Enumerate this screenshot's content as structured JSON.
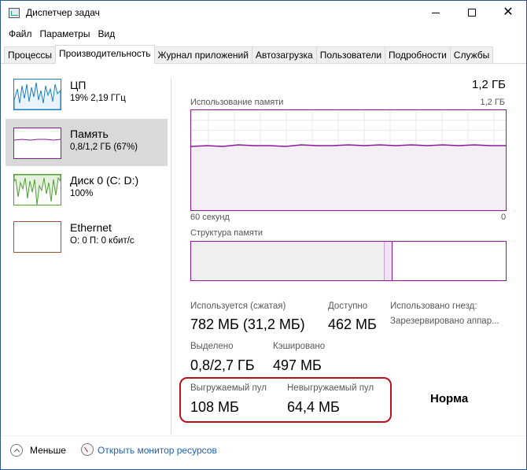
{
  "window": {
    "title": "Диспетчер задач"
  },
  "menu": [
    "Файл",
    "Параметры",
    "Вид"
  ],
  "tabs": [
    {
      "label": "Процессы",
      "active": false
    },
    {
      "label": "Производительность",
      "active": true
    },
    {
      "label": "Журнал приложений",
      "active": false
    },
    {
      "label": "Автозагрузка",
      "active": false
    },
    {
      "label": "Пользователи",
      "active": false
    },
    {
      "label": "Подробности",
      "active": false
    },
    {
      "label": "Службы",
      "active": false
    }
  ],
  "sidebar": {
    "items": [
      {
        "name": "ЦП",
        "detail": "19%  2,19 ГГц",
        "color": "#1c7fbf"
      },
      {
        "name": "Память",
        "detail": "0,8/1,2 ГБ (67%)",
        "color": "#8b1a9b"
      },
      {
        "name": "Диск 0 (C: D:)",
        "detail": "100%",
        "color": "#4da033"
      },
      {
        "name": "Ethernet",
        "detail": "О: 0 П: 0 кбит/с",
        "color": "#a0522d"
      }
    ]
  },
  "main": {
    "total": "1,2 ГБ",
    "usage_chart": {
      "label": "Использование памяти",
      "max_label": "1,2 ГБ",
      "time_left": "60 секунд",
      "time_right": "0",
      "level_percent": 67
    },
    "structure": {
      "label": "Структура памяти",
      "used_fraction": 0.61,
      "modified_fraction": 0.025
    },
    "stats": {
      "in_use_label": "Используется (сжатая)",
      "in_use_value": "782 МБ (31,2 МБ)",
      "available_label": "Доступно",
      "available_value": "462 МБ",
      "slots_label": "Использовано гнезд:",
      "slots_value": "Зарезервировано аппар...",
      "committed_label": "Выделено",
      "committed_value": "0,8/2,7 ГБ",
      "cached_label": "Кэшировано",
      "cached_value": "497 МБ",
      "paged_label": "Выгружаемый пул",
      "paged_value": "108 МБ",
      "nonpaged_label": "Невыгружаемый пул",
      "nonpaged_value": "64,4 МБ"
    },
    "annotation": "Норма"
  },
  "footer": {
    "less_label": "Меньше",
    "monitor_link": "Открыть монитор ресурсов"
  },
  "colors": {
    "memory": "#8b1a9b",
    "highlight": "#c0101a",
    "link": "#1e5fb4"
  }
}
